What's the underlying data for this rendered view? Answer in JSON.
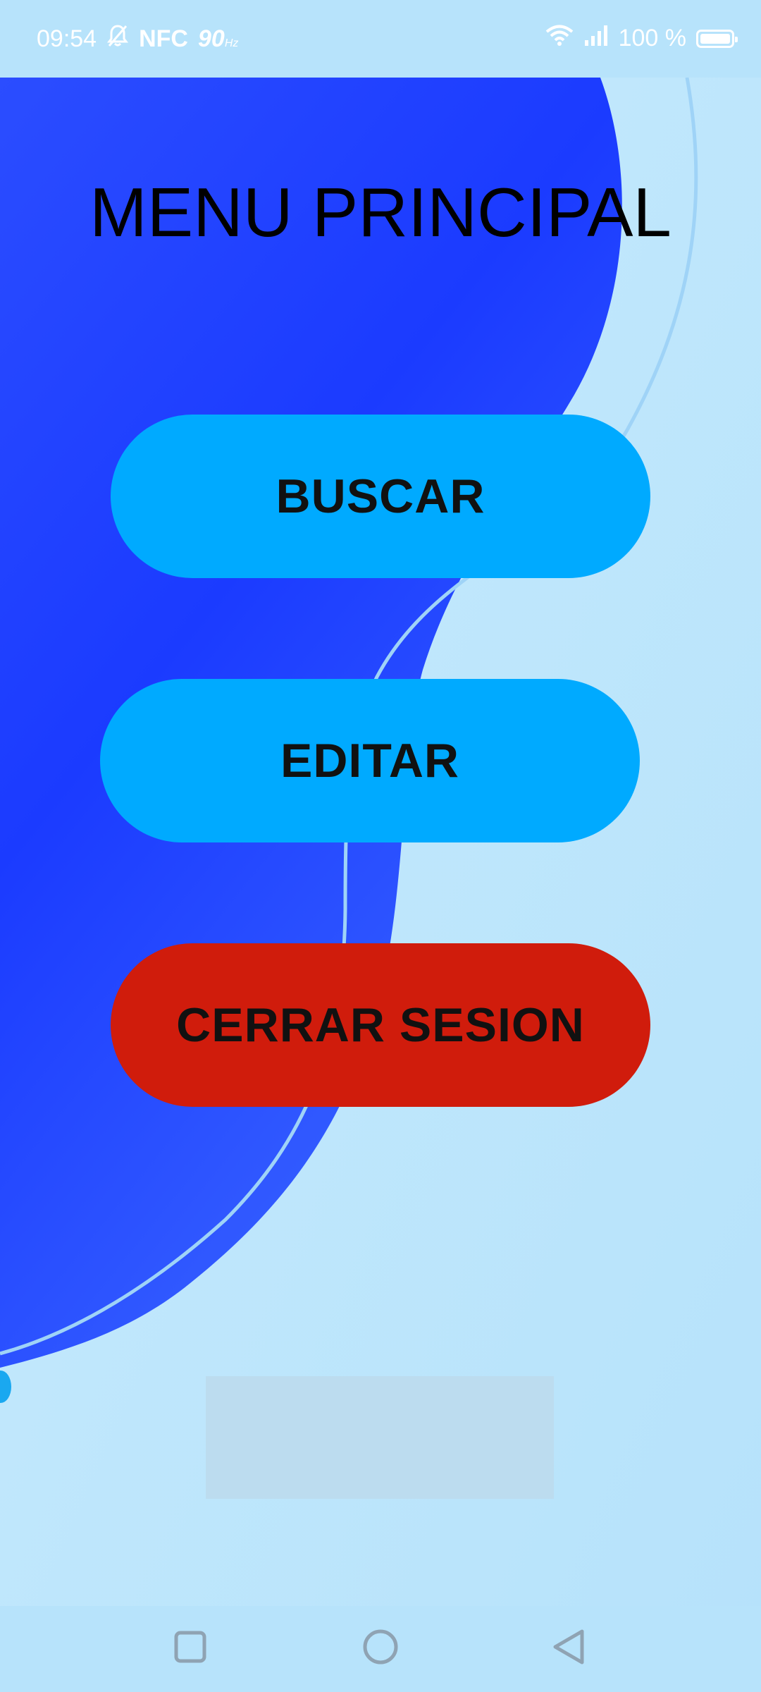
{
  "status_bar": {
    "time": "09:54",
    "nfc": "NFC",
    "refresh_rate": "90",
    "refresh_unit": "Hz",
    "battery_text": "100 %",
    "icons": [
      "mute-bell-icon",
      "wifi-icon",
      "signal-icon",
      "battery-icon"
    ],
    "battery_level": 1.0
  },
  "main": {
    "title": "MENU PRINCIPAL",
    "buttons": {
      "buscar": "BUSCAR",
      "editar": "EDITAR",
      "cerrar": "CERRAR SESION"
    }
  },
  "nav_bar": {
    "icons": [
      "recent-apps-icon",
      "home-icon",
      "back-icon"
    ]
  },
  "colors": {
    "background": "#bde6fb",
    "blue_shape": "#1d3cff",
    "primary_button": "#00aaff",
    "danger_button": "#d01c0c",
    "text": "#000000"
  }
}
